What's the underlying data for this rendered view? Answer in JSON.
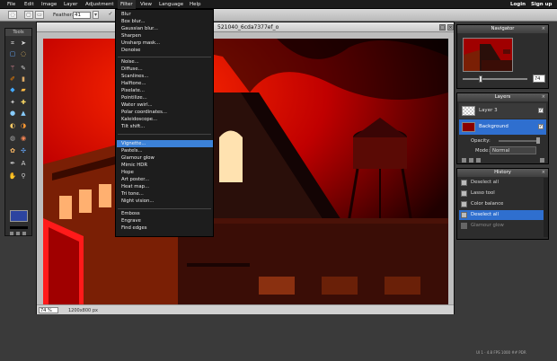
{
  "menubar": {
    "items": [
      "File",
      "Edit",
      "Image",
      "Layer",
      "Adjustment",
      "Filter",
      "View",
      "Language",
      "Help"
    ],
    "login": "Login",
    "signup": "Sign up"
  },
  "options": {
    "feather_label": "Feather:",
    "feather_value": "41"
  },
  "tools": {
    "title": "Tools"
  },
  "document": {
    "title": "521040_6cda7377ef_o",
    "zoom": "74",
    "zoom_unit": "%",
    "dimensions": "1200x800 px"
  },
  "filter_menu": {
    "items": [
      "Blur",
      "Box blur...",
      "Gaussian blur...",
      "Sharpen",
      "Unsharp mask...",
      "Denoise",
      "Noise...",
      "Diffuse...",
      "Scanlines...",
      "Halftone...",
      "Pixelate...",
      "Pointilize...",
      "Water swirl...",
      "Polar coordinates...",
      "Kaleidoscope...",
      "Tilt shift...",
      "Vignette...",
      "Pastels...",
      "Glamour glow",
      "Mimic HDR",
      "Hope",
      "Art poster...",
      "Heat map...",
      "Tri tone...",
      "Night vision...",
      "Emboss",
      "Engrave",
      "Find edges"
    ],
    "highlighted": "Vignette..."
  },
  "navigator": {
    "title": "Navigator",
    "zoom": "74"
  },
  "layers": {
    "title": "Layers",
    "items": [
      {
        "name": "Layer 3"
      },
      {
        "name": "Background"
      }
    ],
    "opacity_label": "Opacity:",
    "mode_label": "Mode:",
    "mode_value": "Normal"
  },
  "history": {
    "title": "History",
    "items": [
      "Deselect all",
      "Lasso tool",
      "Color balance",
      "Deselect all",
      "Glamour glow"
    ]
  },
  "footer": {
    "text": "UI 1 · 4.8 FPS 1000 ## PDR"
  },
  "colors": {
    "menu_highlight": "#3c82d8",
    "foreground": "#2c44a0",
    "image_red": "#c80000"
  }
}
